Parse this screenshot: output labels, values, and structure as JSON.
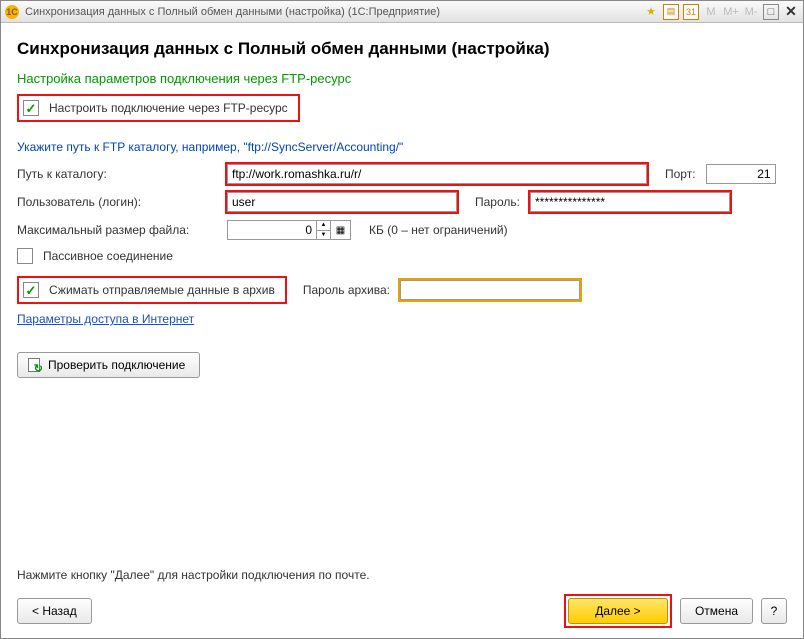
{
  "titlebar": {
    "app_icon_text": "1C",
    "title": "Синхронизация данных с Полный обмен данными (настройка)  (1С:Предприятие)",
    "m1": "M",
    "m2": "M+",
    "m3": "M-",
    "calendar_text": "31"
  },
  "header": {
    "title": "Синхронизация данных с Полный обмен данными (настройка)"
  },
  "section": {
    "title": "Настройка параметров подключения через FTP-ресурс"
  },
  "ftp_checkbox": {
    "label": "Настроить подключение через FTP-ресурс"
  },
  "path_hint": "Укажите путь к FTP каталогу, например, \"ftp://SyncServer/Accounting/\"",
  "path": {
    "label": "Путь к каталогу:",
    "value": "ftp://work.romashka.ru/r/"
  },
  "port": {
    "label": "Порт:",
    "value": "21"
  },
  "user": {
    "label": "Пользователь (логин):",
    "value": "user"
  },
  "password": {
    "label": "Пароль:",
    "value": "***************"
  },
  "maxsize": {
    "label": "Максимальный размер файла:",
    "value": "0",
    "suffix": "КБ   (0 – нет ограничений)"
  },
  "passive": {
    "label": "Пассивное соединение"
  },
  "compress": {
    "label": "Сжимать отправляемые данные в архив"
  },
  "archive_pwd": {
    "label": "Пароль архива:",
    "value": ""
  },
  "inet_link": "Параметры доступа в Интернет",
  "test_btn": "Проверить подключение",
  "footer": {
    "hint": "Нажмите кнопку \"Далее\" для настройки подключения по почте.",
    "back": "< Назад",
    "next": "Далее >",
    "cancel": "Отмена",
    "help": "?"
  }
}
